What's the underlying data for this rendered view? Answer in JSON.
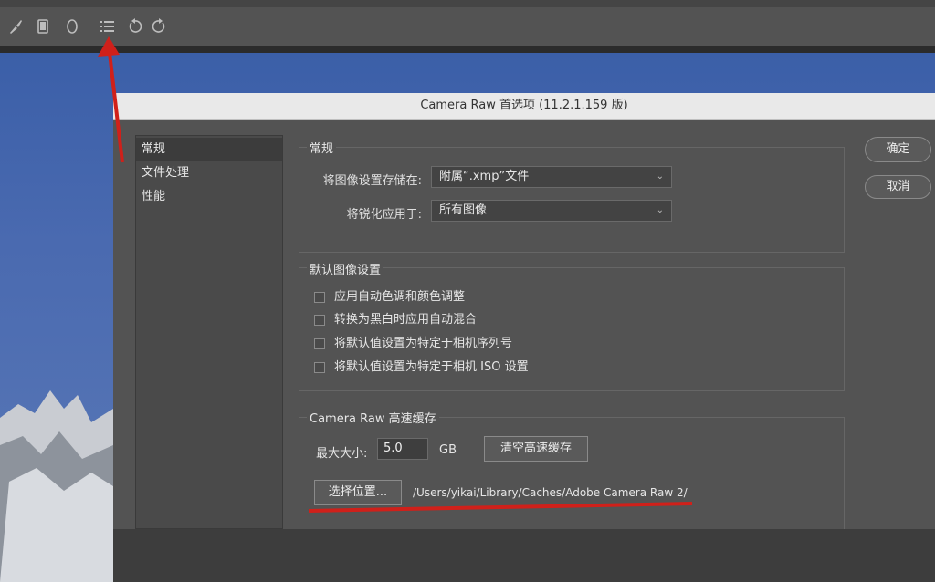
{
  "toolbar": {
    "icons": [
      "brush-icon",
      "mobile-icon",
      "ellipse-icon",
      "list-icon",
      "rotate-left-icon",
      "rotate-right-icon"
    ]
  },
  "dialog": {
    "title": "Camera Raw 首选项 (11.2.1.159 版)",
    "sidebar": [
      "常规",
      "文件处理",
      "性能"
    ],
    "ok_label": "确定",
    "cancel_label": "取消"
  },
  "general": {
    "section_title": "常规",
    "save_settings_label": "将图像设置存储在:",
    "save_settings_value": "附属“.xmp”文件",
    "sharpen_label": "将锐化应用于:",
    "sharpen_value": "所有图像"
  },
  "defaults": {
    "section_title": "默认图像设置",
    "options": [
      "应用自动色调和颜色调整",
      "转换为黑白时应用自动混合",
      "将默认值设置为特定于相机序列号",
      "将默认值设置为特定于相机 ISO 设置"
    ]
  },
  "cache": {
    "section_title": "Camera Raw 高速缓存",
    "max_size_label": "最大大小:",
    "max_size_value": "5.0",
    "unit": "GB",
    "purge_label": "清空高速缓存",
    "choose_location_label": "选择位置...",
    "path": "/Users/yikai/Library/Caches/Adobe Camera Raw 2/"
  },
  "colors": {
    "annotation": "#d0201a",
    "dialog_bg": "#535353",
    "titlebar_bg": "#e9e9e9"
  }
}
